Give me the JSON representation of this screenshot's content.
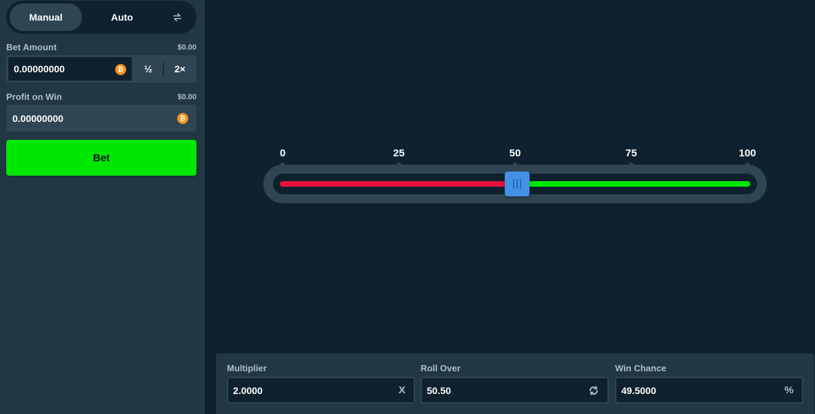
{
  "sidebar": {
    "tabs": {
      "manual": "Manual",
      "auto": "Auto"
    },
    "bet_amount": {
      "label": "Bet Amount",
      "usd": "$0.00",
      "value": "0.00000000",
      "currency_icon": "bitcoin-icon",
      "half_label": "½",
      "double_label": "2×"
    },
    "profit": {
      "label": "Profit on Win",
      "usd": "$0.00",
      "value": "0.00000000",
      "currency_icon": "bitcoin-icon"
    },
    "bet_button": "Bet"
  },
  "slider": {
    "ticks": [
      "0",
      "25",
      "50",
      "75",
      "100"
    ],
    "value": 50.5,
    "min": 0,
    "max": 100,
    "lose_color": "#e9113c",
    "win_color": "#00e701"
  },
  "stats": {
    "multiplier": {
      "label": "Multiplier",
      "value": "2.0000",
      "suffix": "X"
    },
    "roll_over": {
      "label": "Roll Over",
      "value": "50.50",
      "suffix_icon": "refresh-icon"
    },
    "win_chance": {
      "label": "Win Chance",
      "value": "49.5000",
      "suffix": "%"
    }
  },
  "colors": {
    "accent_green": "#00e701",
    "accent_red": "#e9113c",
    "handle_blue": "#4391e7",
    "bitcoin_orange": "#f7931a"
  }
}
